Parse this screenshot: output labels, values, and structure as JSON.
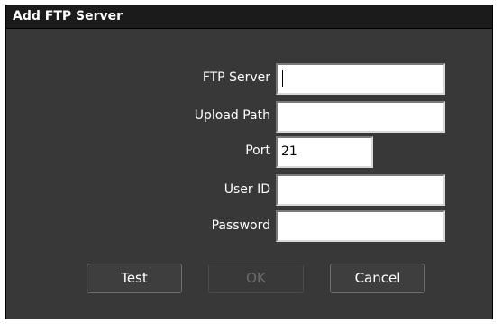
{
  "dialog": {
    "title": "Add FTP Server"
  },
  "fields": [
    {
      "label": "FTP Server",
      "value": "",
      "focused": true
    },
    {
      "label": "Upload Path",
      "value": ""
    },
    {
      "label": "Port",
      "value": "21"
    },
    {
      "label": "User ID",
      "value": ""
    },
    {
      "label": "Password",
      "value": ""
    }
  ],
  "buttons": {
    "test": "Test",
    "ok": "OK",
    "cancel": "Cancel",
    "ok_disabled": true
  },
  "colors": {
    "dialog_background": "#383838",
    "titlebar_background": "#1b1b1b",
    "text": "#ffffff",
    "disabled_text": "#6a6a6a"
  }
}
